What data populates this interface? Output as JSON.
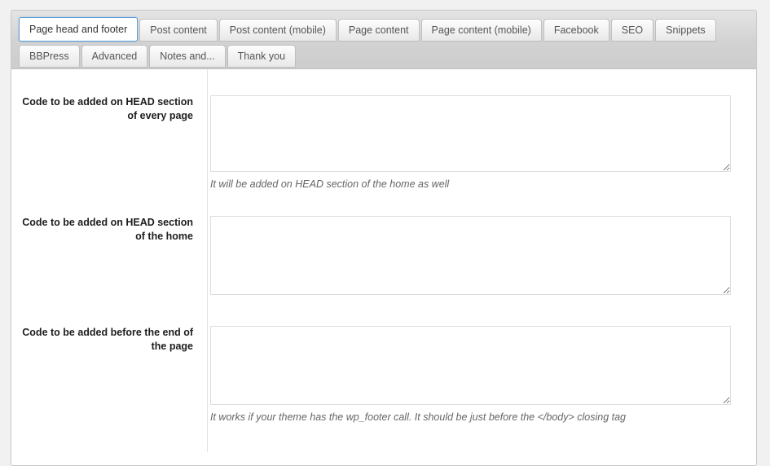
{
  "tabs": {
    "row1": [
      {
        "label": "Page head and footer",
        "active": true
      },
      {
        "label": "Post content",
        "active": false
      },
      {
        "label": "Post content (mobile)",
        "active": false
      },
      {
        "label": "Page content",
        "active": false
      },
      {
        "label": "Page content (mobile)",
        "active": false
      },
      {
        "label": "Facebook",
        "active": false
      },
      {
        "label": "SEO",
        "active": false
      },
      {
        "label": "Snippets",
        "active": false
      }
    ],
    "row2": [
      {
        "label": "BBPress",
        "active": false
      },
      {
        "label": "Advanced",
        "active": false
      },
      {
        "label": "Notes and...",
        "active": false
      },
      {
        "label": "Thank you",
        "active": false
      }
    ]
  },
  "fields": [
    {
      "label": "Code to be added on HEAD section of every page",
      "value": "",
      "hint": "It will be added on HEAD section of the home as well"
    },
    {
      "label": "Code to be added on HEAD section of the home",
      "value": "",
      "hint": ""
    },
    {
      "label": "Code to be added before the end of the page",
      "value": "",
      "hint": "It works if your theme has the wp_footer call. It should be just before the </body> closing tag"
    }
  ],
  "colors": {
    "accent": "#5b9dd9",
    "page_background": "#f1f1f1",
    "tabbar_background": "#d2d2d2",
    "panel_background": "#ffffff",
    "label_text": "#1d1d1d",
    "hint_text": "#666666",
    "field_border": "#dddddd"
  }
}
